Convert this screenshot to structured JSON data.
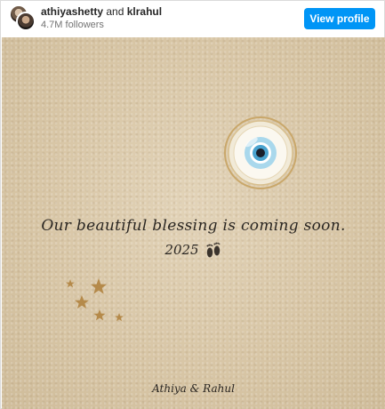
{
  "header": {
    "user1": "athiyashetty",
    "conjunction": "and",
    "user2": "klrahul",
    "followers": "4.7M followers",
    "view_profile_label": "View profile"
  },
  "post": {
    "message": "Our beautiful blessing is coming soon.",
    "year": "2025",
    "signature": "Athiya & Rahul",
    "icons": [
      "evil-eye-icon",
      "baby-feet-icon",
      "stars-icon"
    ]
  },
  "colors": {
    "accent": "#0095f6",
    "sand": "#d8c6a6",
    "text": "#2a2622",
    "eye_blue": "#9fd3e8",
    "gold": "#b58a4a"
  }
}
